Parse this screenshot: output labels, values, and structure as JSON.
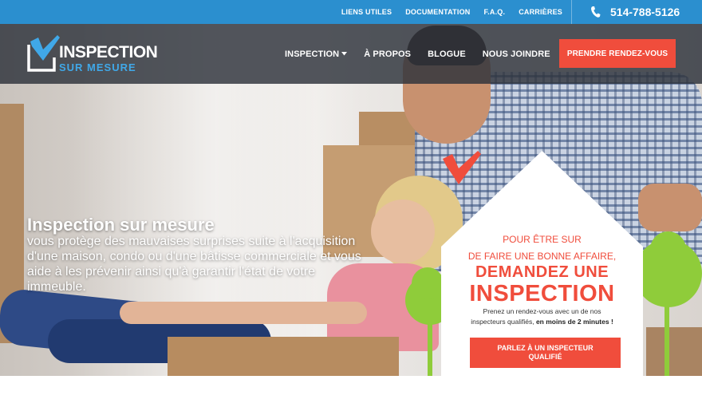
{
  "topbar": {
    "links": [
      "LIENS UTILES",
      "DOCUMENTATION",
      "F.A.Q.",
      "CARRIÈRES"
    ],
    "phone": "514-788-5126"
  },
  "brand": {
    "name_line1": "INSPECTION",
    "name_line2": "SUR MESURE",
    "accent": "#2b8fcf",
    "cta_color": "#f04d3c"
  },
  "nav": {
    "items": [
      {
        "label": "INSPECTION",
        "has_dropdown": true
      },
      {
        "label": "À PROPOS"
      },
      {
        "label": "BLOGUE"
      },
      {
        "label": "NOUS JOINDRE"
      }
    ],
    "cta_label": "PRENDRE RENDEZ-VOUS"
  },
  "hero": {
    "title": "Inspection sur mesure",
    "body": "vous protège des mauvaises surprises suite à l'acquisition d'une maison, condo ou d'une bâtisse commerciale et vous aide à les prévenir ainsi qu'à garantir l'état de votre immeuble."
  },
  "callout": {
    "line1": "POUR ÊTRE SUR",
    "line2": "DE FAIRE UNE BONNE AFFAIRE,",
    "line3": "DEMANDEZ UNE",
    "line4": "INSPECTION",
    "para1": "Prenez un rendez-vous avec un de nos",
    "para2_pre": "inspecteurs qualifiés, ",
    "para2_bold": "en moins de 2 minutes !",
    "button": "PARLEZ À UN INSPECTEUR QUALIFIÉ"
  }
}
